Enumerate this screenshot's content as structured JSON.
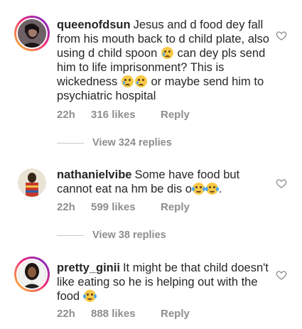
{
  "comments": [
    {
      "username": "queenofdsun",
      "parts": [
        "Jesus and d food dey fall from his mouth back to d child plate, also using d child spoon ",
        " can dey pls send him to life imprisonment? This is wickedness ",
        " or maybe send him to psychiatric hospital"
      ],
      "time": "22h",
      "likes": "316 likes",
      "reply": "Reply",
      "view_replies": "View 324 replies"
    },
    {
      "username": "nathanielvibe",
      "parts": [
        "Some have food but cannot eat na hm be dis o",
        "."
      ],
      "time": "22h",
      "likes": "599 likes",
      "reply": "Reply",
      "view_replies": "View 38 replies"
    },
    {
      "username": "pretty_ginii",
      "parts": [
        "It might be that child doesn't like eating so he is helping out with the food "
      ],
      "time": "22h",
      "likes": "888 likes",
      "reply": "Reply"
    }
  ],
  "icons": {
    "like": "heart-outline-icon",
    "emoji_sad": "crying-face-emoji",
    "emoji_joy": "face-with-tears-of-joy-emoji"
  },
  "colors": {
    "text": "#262626",
    "secondary": "#8e8e8e",
    "story_ring_start": "#f9ce34",
    "story_ring_end": "#6228d7"
  }
}
